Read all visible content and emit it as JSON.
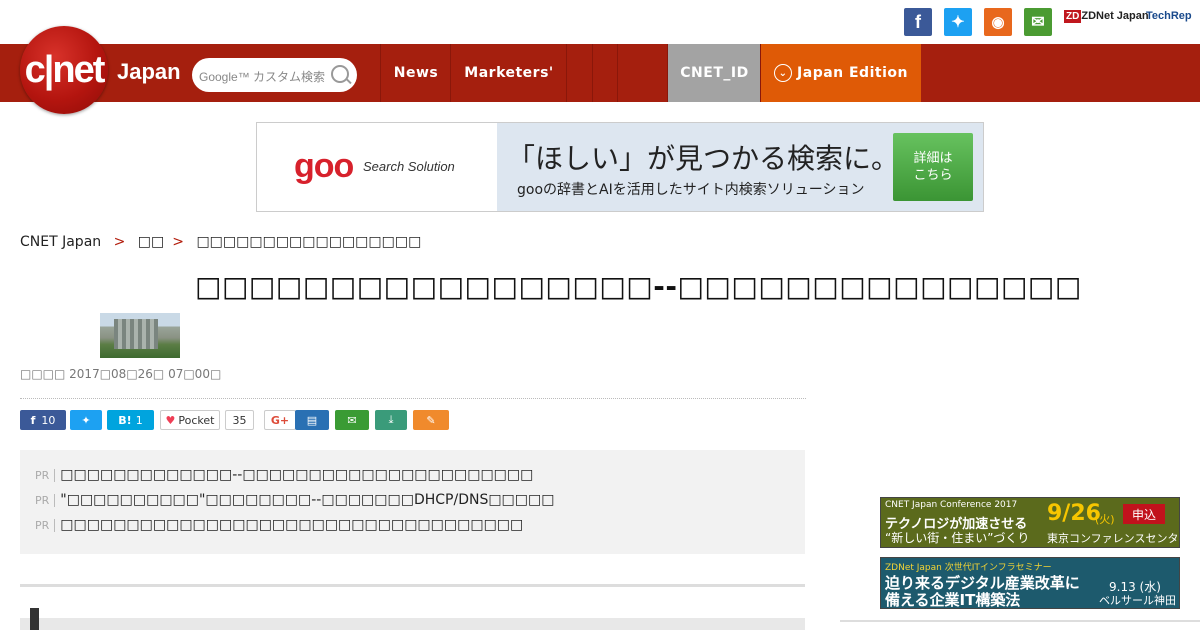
{
  "social": {
    "brand": "ZDNet Japan",
    "brand2": "TechRep"
  },
  "header": {
    "logo_text": "c|net",
    "edition_word": "Japan",
    "search_placeholder": "Google™ カスタム検索",
    "nav": [
      "News",
      "Marketers'",
      "",
      "",
      "",
      "CNET_ID",
      "Japan Edition"
    ]
  },
  "banner": {
    "logo": "goo",
    "logo_sub": "Search Solution",
    "headline": "「ほしい」が見つかる検索に。",
    "sub": "gooの辞書とAIを活用したサイト内検索ソリューション",
    "button": "詳細は\nこちら"
  },
  "breadcrumb": [
    "CNET Japan",
    "□□",
    "□□□□□□□□□□□□□□□□□"
  ],
  "article": {
    "title": "□□□□□□□□□□□□□□□□□--□□□□□□□□□□□□□□□",
    "date": "□□□□  2017□08□26□ 07□00□"
  },
  "share": {
    "fb_count": "10",
    "hatena_count": "1",
    "pocket_label": "Pocket",
    "pocket_count": "35",
    "gplus_label": "G+"
  },
  "pr_items": [
    "□□□□□□□□□□□□□--□□□□□□□□□□□□□□□□□□□□□□",
    "\"□□□□□□□□□□\"□□□□□□□□--□□□□□□□DHCP/DNS□□□□□",
    "□□□□□□□□□□□□□□□□□□□□□□□□□□□□□□□□□□□"
  ],
  "pr_tag": "PR",
  "ads": {
    "ad1_top": "CNET Japan Conference 2017",
    "ad1_l1": "テクノロジが加速させる",
    "ad1_l2": "“新しい街・住まい”づくり",
    "ad1_date": "9/26",
    "ad1_dow": "(火)",
    "ad1_btn": "申込",
    "ad1_venue": "東京コンファレンスセンター",
    "ad2_top": "ZDNet Japan 次世代ITインフラセミナー",
    "ad2_l1": "迫り来るデジタル産業改革に",
    "ad2_l2": "備える企業IT構築法",
    "ad2_date": "9.13 (水)",
    "ad2_venue": "ベルサール神田"
  },
  "colors": {
    "header_red": "#a51f0e",
    "orange": "#df5a06",
    "id_gray": "#a3a3a3"
  }
}
